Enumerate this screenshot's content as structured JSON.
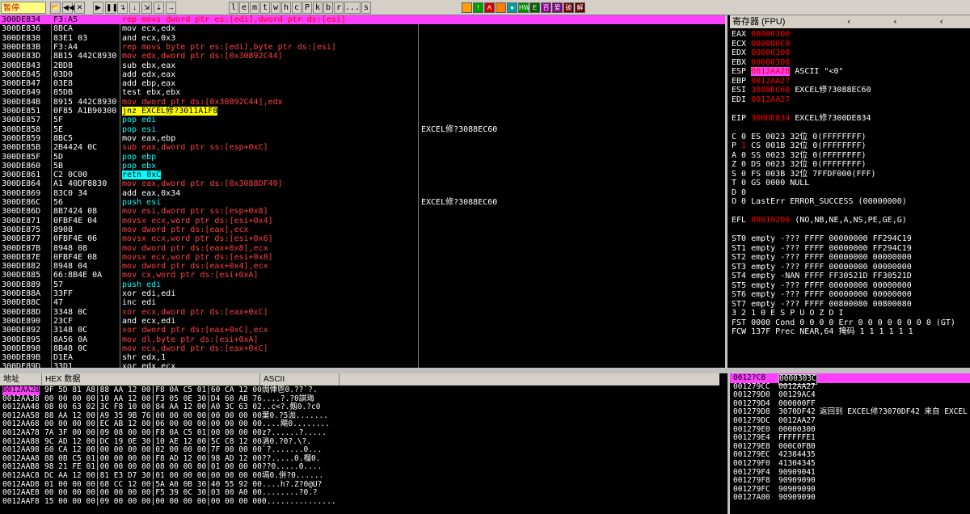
{
  "toolbar": {
    "status": "暂停",
    "buttons": [
      "📂",
      "◀◀",
      "✕",
      "▶",
      "❚❚",
      "↴",
      "↓",
      "⇲",
      "⇣",
      "→"
    ],
    "letters": [
      "l",
      "e",
      "m",
      "t",
      "w",
      "h",
      "c",
      "P",
      "k",
      "b",
      "r",
      "...",
      "s"
    ],
    "colors": [
      {
        "bg": "#ffa000",
        "t": ""
      },
      {
        "bg": "#00a000",
        "t": "!"
      },
      {
        "bg": "#d00000",
        "t": "A"
      },
      {
        "bg": "#ff8000",
        "t": ""
      },
      {
        "bg": "#00a0a0",
        "t": "●"
      },
      {
        "bg": "#009000",
        "t": "HW"
      },
      {
        "bg": "#006000",
        "t": "E"
      },
      {
        "bg": "#900090",
        "t": "百"
      },
      {
        "bg": "#800080",
        "t": "爱"
      },
      {
        "bg": "#700000",
        "t": "破"
      },
      {
        "bg": "#600000",
        "t": "解"
      }
    ]
  },
  "cpu": {
    "rows": [
      {
        "a": "300DE834",
        "h": "F3:A5",
        "d": "rep movs dword ptr es:[edi],dword ptr ds:[esi]",
        "c": "",
        "sel": true
      },
      {
        "a": "300DE836",
        "h": "8BCA",
        "d": "mov ecx,edx",
        "c": ""
      },
      {
        "a": "300DE838",
        "h": "83E1 03",
        "d": "and ecx,0x3",
        "c": ""
      },
      {
        "a": "300DE83B",
        "h": "F3:A4",
        "d": "rep movs byte ptr es:[edi],byte ptr ds:[esi]",
        "c": ""
      },
      {
        "a": "300DE83D",
        "h": "8B15 442C8930",
        "d": "mov edx,dword ptr ds:[0x30892C44]",
        "c": ""
      },
      {
        "a": "300DE843",
        "h": "2BD8",
        "d": "sub ebx,eax",
        "c": ""
      },
      {
        "a": "300DE845",
        "h": "03D0",
        "d": "add edx,eax",
        "c": ""
      },
      {
        "a": "300DE847",
        "h": "03E8",
        "d": "add ebp,eax",
        "c": ""
      },
      {
        "a": "300DE849",
        "h": "85DB",
        "d": "test ebx,ebx",
        "c": ""
      },
      {
        "a": "300DE84B",
        "h": "8915 442C8930",
        "d": "mov dword ptr ds:[0x30892C44],edx",
        "c": ""
      },
      {
        "a": "300DE851",
        "h": "0F85 A1B90300",
        "d": "jnz EXCEL修?3011A1F8",
        "c": ""
      },
      {
        "a": "300DE857",
        "h": "5F",
        "d": "pop edi",
        "c": ""
      },
      {
        "a": "300DE858",
        "h": "5E",
        "d": "pop esi",
        "c": "EXCEL修?3088EC60"
      },
      {
        "a": "300DE859",
        "h": "8BC5",
        "d": "mov eax,ebp",
        "c": ""
      },
      {
        "a": "300DE85B",
        "h": "2B4424 0C",
        "d": "sub eax,dword ptr ss:[esp+0xC]",
        "c": ""
      },
      {
        "a": "300DE85F",
        "h": "5D",
        "d": "pop ebp",
        "c": ""
      },
      {
        "a": "300DE860",
        "h": "5B",
        "d": "pop ebx",
        "c": ""
      },
      {
        "a": "300DE861",
        "h": "C2 0C00",
        "d": "retn 0xC",
        "c": ""
      },
      {
        "a": "300DE864",
        "h": "A1 40DF8830",
        "d": "mov eax,dword ptr ds:[0x3088DF40]",
        "c": ""
      },
      {
        "a": "300DE869",
        "h": "83C0 34",
        "d": "add eax,0x34",
        "c": ""
      },
      {
        "a": "300DE86C",
        "h": "56",
        "d": "push esi",
        "c": "EXCEL修?3088EC60"
      },
      {
        "a": "300DE86D",
        "h": "8B7424 08",
        "d": "mov esi,dword ptr ss:[esp+0x8]",
        "c": ""
      },
      {
        "a": "300DE871",
        "h": "0FBF4E 04",
        "d": "movsx ecx,word ptr ds:[esi+0x4]",
        "c": ""
      },
      {
        "a": "300DE875",
        "h": "8908",
        "d": "mov dword ptr ds:[eax],ecx",
        "c": ""
      },
      {
        "a": "300DE877",
        "h": "0FBF4E 06",
        "d": "movsx ecx,word ptr ds:[esi+0x6]",
        "c": ""
      },
      {
        "a": "300DE87B",
        "h": "8948 08",
        "d": "mov dword ptr ds:[eax+0x8],ecx",
        "c": ""
      },
      {
        "a": "300DE87E",
        "h": "0FBF4E 08",
        "d": "movsx ecx,word ptr ds:[esi+0x8]",
        "c": ""
      },
      {
        "a": "300DE882",
        "h": "8948 04",
        "d": "mov dword ptr ds:[eax+0x4],ecx",
        "c": ""
      },
      {
        "a": "300DE885",
        "h": "66:8B4E 0A",
        "d": "mov cx,word ptr ds:[esi+0xA]",
        "c": ""
      },
      {
        "a": "300DE889",
        "h": "57",
        "d": "push edi",
        "c": ""
      },
      {
        "a": "300DE88A",
        "h": "33FF",
        "d": "xor edi,edi",
        "c": ""
      },
      {
        "a": "300DE88C",
        "h": "47",
        "d": "inc edi",
        "c": ""
      },
      {
        "a": "300DE88D",
        "h": "3348 0C",
        "d": "xor ecx,dword ptr ds:[eax+0xC]",
        "c": ""
      },
      {
        "a": "300DE890",
        "h": "23CF",
        "d": "and ecx,edi",
        "c": ""
      },
      {
        "a": "300DE892",
        "h": "3148 0C",
        "d": "xor dword ptr ds:[eax+0xC],ecx",
        "c": ""
      },
      {
        "a": "300DE895",
        "h": "8A56 0A",
        "d": "mov dl,byte ptr ds:[esi+0xA]",
        "c": ""
      },
      {
        "a": "300DE898",
        "h": "8B48 0C",
        "d": "mov ecx,dword ptr ds:[eax+0xC]",
        "c": ""
      },
      {
        "a": "300DE89B",
        "h": "D1EA",
        "d": "shr edx,1",
        "c": ""
      },
      {
        "a": "300DE89D",
        "h": "33D1",
        "d": "xor edx,ecx",
        "c": ""
      }
    ]
  },
  "registers": {
    "title": "寄存器 (FPU)",
    "arrows": "‹ ‹ ‹",
    "lines": [
      {
        "l": "EAX ",
        "v": "00000300",
        "rest": ""
      },
      {
        "l": "ECX ",
        "v": "000000C0",
        "rest": ""
      },
      {
        "l": "EDX ",
        "v": "00000300",
        "rest": ""
      },
      {
        "l": "EBX ",
        "v": "00000300",
        "rest": ""
      },
      {
        "l": "ESP ",
        "v": "0012AA28",
        "rest": " ASCII \"<0\"",
        "sel": true
      },
      {
        "l": "EBP ",
        "v": "0012AA27",
        "rest": ""
      },
      {
        "l": "ESI ",
        "v": "3088EC60",
        "rest": " EXCEL修?3088EC60"
      },
      {
        "l": "EDI ",
        "v": "0012AA27",
        "rest": ""
      },
      {
        "l": "",
        "v": "",
        "rest": ""
      },
      {
        "l": "EIP ",
        "v": "300DE834",
        "rest": " EXCEL修?300DE834"
      },
      {
        "l": "",
        "v": "",
        "rest": ""
      },
      {
        "l": "C 0  ES 0023 32位 0(FFFFFFFF)",
        "v": "",
        "rest": ""
      },
      {
        "l": "P ",
        "v": "1",
        "rest": "  CS 001B 32位 0(FFFFFFFF)"
      },
      {
        "l": "A 0  SS 0023 32位 0(FFFFFFFF)",
        "v": "",
        "rest": ""
      },
      {
        "l": "Z 0  DS 0023 32位 0(FFFFFFFF)",
        "v": "",
        "rest": ""
      },
      {
        "l": "S 0  FS 003B 32位 7FFDF000(FFF)",
        "v": "",
        "rest": ""
      },
      {
        "l": "T 0  GS 0000 NULL",
        "v": "",
        "rest": ""
      },
      {
        "l": "D 0",
        "v": "",
        "rest": ""
      },
      {
        "l": "O 0  LastErr ERROR_SUCCESS (00000000)",
        "v": "",
        "rest": ""
      },
      {
        "l": "",
        "v": "",
        "rest": ""
      },
      {
        "l": "EFL ",
        "v": "00010206",
        "rest": " (NO,NB,NE,A,NS,PE,GE,G)"
      },
      {
        "l": "",
        "v": "",
        "rest": ""
      },
      {
        "l": "ST0 empty -??? FFFF 00000000 FF294C19",
        "v": "",
        "rest": ""
      },
      {
        "l": "ST1 empty -??? FFFF 00000000 FF294C19",
        "v": "",
        "rest": ""
      },
      {
        "l": "ST2 empty -??? FFFF 00000000 00000000",
        "v": "",
        "rest": ""
      },
      {
        "l": "ST3 empty -??? FFFF 00000000 00000000",
        "v": "",
        "rest": ""
      },
      {
        "l": "ST4 empty -NAN FFFF FF30521D FF30521D",
        "v": "",
        "rest": ""
      },
      {
        "l": "ST5 empty -??? FFFF 00000000 00000000",
        "v": "",
        "rest": ""
      },
      {
        "l": "ST6 empty -??? FFFF 00000000 00000000",
        "v": "",
        "rest": ""
      },
      {
        "l": "ST7 empty -??? FFFF 00800080 00800080",
        "v": "",
        "rest": ""
      },
      {
        "l": "               3 2 1 0      E S P U O Z D I",
        "v": "",
        "rest": ""
      },
      {
        "l": "FST 0000  Cond 0 0 0 0  Err 0 0 0 0 0 0 0 0  (GT)",
        "v": "",
        "rest": ""
      },
      {
        "l": "FCW 137F  Prec NEAR,64  掩码    1 1 1 1 1 1",
        "v": "",
        "rest": ""
      }
    ]
  },
  "dump": {
    "headers": [
      "地址",
      "HEX 数据",
      "ASCII"
    ],
    "rows": [
      {
        "a": "0012AA28",
        "h": "9F 5D 81 A8|88 AA 12 00|F8 0A C5 01|60 CA 12 00",
        "s": "焗俥鬯0.??`?."
      },
      {
        "a": "0012AA38",
        "h": "00 00 00 00|10 AA 12 00|F3 05 0E 30|D4 60 AB 76",
        "s": "....?.?0諆珻"
      },
      {
        "a": "0012AA48",
        "h": "08 00 63 02|3C F8 10 00|84 AA 12 00|A0 3C 63 02",
        "s": "..c<?.剱0.?c0"
      },
      {
        "a": "0012AA58",
        "h": "88 AA 12 00|A9 35 9B 76|00 00 00 00|00 00 00 00",
        "s": "葉0.?5泇......."
      },
      {
        "a": "0012AA68",
        "h": "00 00 00 00|EC AB 12 00|06 00 00 00|00 00 00 00",
        "s": "....飓0........"
      },
      {
        "a": "0012AA78",
        "h": "7A 3F 00 00|09 08 00 00|F8 0A C5 01|00 00 00 00",
        "s": "z?......?....."
      },
      {
        "a": "0012AA88",
        "h": "9C AD 12 00|DC 19 0E 30|10 AE 12 00|5C C8 12 00",
        "s": "滈0.?0?.\\?."
      },
      {
        "a": "0012AA98",
        "h": "60 CA 12 00|00 00 00 00|02 00 00 00|7F 00 00 00",
        "s": "`?.......0..."
      },
      {
        "a": "0012AAA8",
        "h": "88 0B C5 01|00 00 00 00|F8 AD 12 00|98 AD 12 00",
        "s": "??.....0.榴0."
      },
      {
        "a": "0012AAB8",
        "h": "98 21 FE 01|00 00 00 00|08 00 00 00|01 00 00 00",
        "s": "??0.....0...."
      },
      {
        "a": "0012AAC8",
        "h": "DC AA 12 00|81 E3 D7 30|01 00 00 00|00 00 00 00",
        "s": "塥0.併?0......"
      },
      {
        "a": "0012AAD8",
        "h": "01 00 00 00|68 CC 12 00|5A A0 0B 30|40 55 92 00",
        "s": "....h?.Z?0@U?"
      },
      {
        "a": "0012AAE8",
        "h": "00 00 00 00|00 00 00 00|F5 39 0C 30|03 00 A0 00",
        "s": "........?0.?"
      },
      {
        "a": "0012AAF8",
        "h": "15 00 00 00|09 00 00 00|00 00 00 00|00 00 00 00",
        "s": "0..............."
      }
    ]
  },
  "stack": {
    "rows": [
      {
        "a": "0012?C8",
        "v": "0000303C",
        "c": "",
        "sel": true
      },
      {
        "a": "001279CC",
        "v": "0012AA27",
        "c": ""
      },
      {
        "a": "001279D0",
        "v": "00129AC4",
        "c": ""
      },
      {
        "a": "001279D4",
        "v": "000000FF",
        "c": ""
      },
      {
        "a": "001279D8",
        "v": "3070DF42",
        "c": "返回到 EXCEL修?3070DF42 来自 EXCEL"
      },
      {
        "a": "001279DC",
        "v": "0012AA27",
        "c": ""
      },
      {
        "a": "001279E0",
        "v": "00000300",
        "c": ""
      },
      {
        "a": "001279E4",
        "v": "FFFFFFE1",
        "c": ""
      },
      {
        "a": "001279E8",
        "v": "000C0FB0",
        "c": ""
      },
      {
        "a": "001279EC",
        "v": "42384435",
        "c": ""
      },
      {
        "a": "001279F0",
        "v": "41304345",
        "c": ""
      },
      {
        "a": "001279F4",
        "v": "90909041",
        "c": ""
      },
      {
        "a": "001279F8",
        "v": "90909090",
        "c": ""
      },
      {
        "a": "001279FC",
        "v": "90909090",
        "c": ""
      },
      {
        "a": "00127A00",
        "v": "90909090",
        "c": ""
      }
    ]
  }
}
